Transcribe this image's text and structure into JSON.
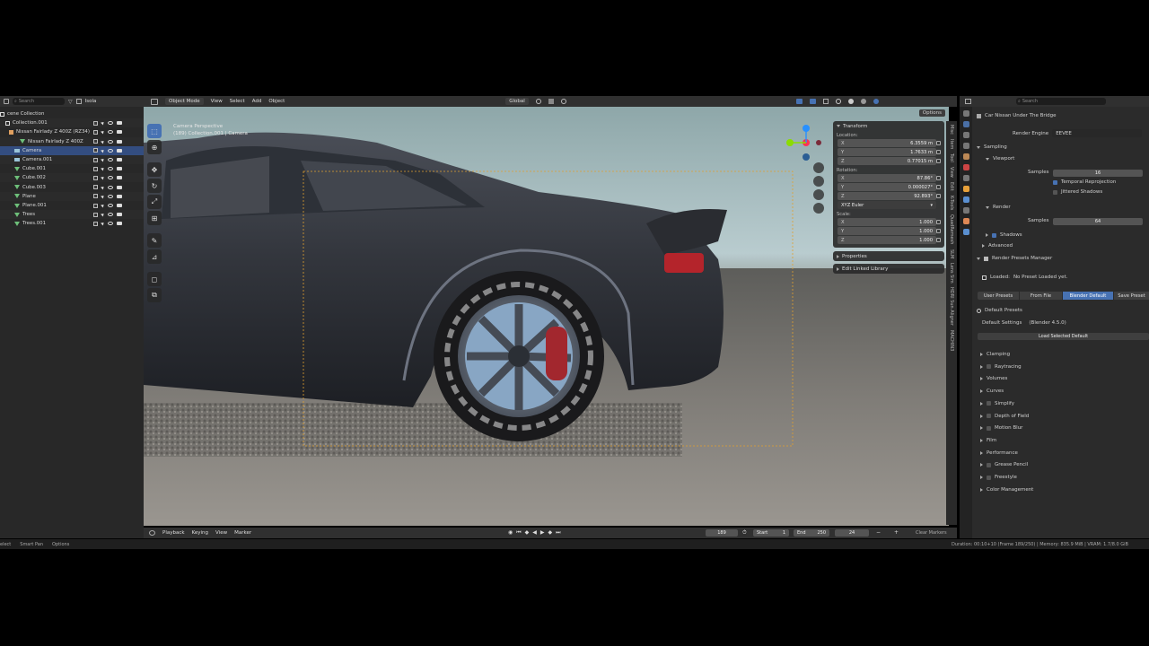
{
  "outliner": {
    "search_placeholder": "Search",
    "isolate_label": "Isola",
    "rows": [
      {
        "label": "cene Collection",
        "kind": "collection"
      },
      {
        "label": "Collection.001",
        "kind": "collection"
      },
      {
        "label": "Nissan Fairlady Z 400Z (RZ34)",
        "kind": "armature"
      },
      {
        "label": "Nissan Fairlady Z 400Z",
        "kind": "mesh"
      },
      {
        "label": "Camera",
        "kind": "camera",
        "selected": true
      },
      {
        "label": "Camera.001",
        "kind": "camera"
      },
      {
        "label": "Cube.001",
        "kind": "mesh"
      },
      {
        "label": "Cube.002",
        "kind": "mesh"
      },
      {
        "label": "Cube.003",
        "kind": "mesh"
      },
      {
        "label": "Plane",
        "kind": "mesh"
      },
      {
        "label": "Plane.001",
        "kind": "mesh"
      },
      {
        "label": "Trees",
        "kind": "mesh"
      },
      {
        "label": "Trees.001",
        "kind": "mesh"
      }
    ]
  },
  "viewport": {
    "mode": "Object Mode",
    "menus": [
      "View",
      "Select",
      "Add",
      "Object"
    ],
    "transform_orientation": "Global",
    "options_label": "Options",
    "overlay_line1": "Camera Perspective",
    "overlay_line2": "(189) Collection.001 | Camera"
  },
  "npanel": {
    "transform_label": "Transform",
    "location_label": "Location:",
    "location": [
      {
        "axis": "X",
        "value": "6.3559 m"
      },
      {
        "axis": "Y",
        "value": "1.7633 m"
      },
      {
        "axis": "Z",
        "value": "0.77015 m"
      }
    ],
    "rotation_label": "Rotation:",
    "rotation": [
      {
        "axis": "X",
        "value": "87.86°"
      },
      {
        "axis": "Y",
        "value": "0.000027°"
      },
      {
        "axis": "Z",
        "value": "92.893°"
      }
    ],
    "rotation_mode": "XYZ Euler",
    "scale_label": "Scale:",
    "scale": [
      {
        "axis": "X",
        "value": "1.000"
      },
      {
        "axis": "Y",
        "value": "1.000"
      },
      {
        "axis": "Z",
        "value": "1.000"
      }
    ],
    "properties_label": "Properties",
    "linked_library_label": "Edit Linked Library",
    "tabs": [
      "Misc",
      "Item",
      "Tool",
      "View",
      "Edit",
      "K-Tools",
      "QuadRemesh",
      "SLM",
      "Lens Sim",
      "HDRI Sun Aligner",
      "MACHIN3"
    ]
  },
  "properties": {
    "search_placeholder": "Search",
    "scene_name": "Car Nissan Under The Bridge",
    "render_engine_label": "Render Engine",
    "render_engine": "EEVEE",
    "sampling_label": "Sampling",
    "viewport_label": "Viewport",
    "viewport_samples_label": "Samples",
    "viewport_samples": "16",
    "temporal_reprojection": "Temporal Reprojection",
    "jittered_shadows": "Jittered Shadows",
    "render_label": "Render",
    "render_samples_label": "Samples",
    "render_samples": "64",
    "shadows_label": "Shadows",
    "advanced_label": "Advanced",
    "presets_manager_label": "Render Presets Manager",
    "loaded_label": "Loaded:",
    "loaded_value": "No Preset Loaded yet.",
    "tabs": [
      "User Presets",
      "From File",
      "Blender Default",
      "Save Preset"
    ],
    "default_presets_label": "Default Presets",
    "default_settings_label": "Default Settings",
    "default_settings_value": "(Blender 4.5.0)",
    "load_selected_label": "Load Selected Default",
    "sections": [
      "Clamping",
      "Raytracing",
      "Volumes",
      "Curves",
      "Simplify",
      "Depth of Field",
      "Motion Blur",
      "Film",
      "Performance",
      "Grease Pencil",
      "Freestyle",
      "Color Management"
    ]
  },
  "timeline": {
    "menus": [
      "Playback",
      "Keying",
      "View",
      "Marker"
    ],
    "current_frame": "189",
    "start_label": "Start",
    "start": "1",
    "end_label": "End",
    "end": "250",
    "fps_field": "24",
    "clear_markers": "Clear Markers"
  },
  "statusbar": {
    "left_items": [
      "elect",
      "Smart Pan",
      "Options"
    ],
    "right_text": "Duration: 00:10+10 (Frame 189/250) | Memory: 835.9 MiB | VRAM: 1.7/8.0 GiB"
  },
  "colors": {
    "accent": "#4772b3",
    "panel": "#2b2b2b",
    "header": "#303030",
    "camera_frame": "#e0a030"
  }
}
